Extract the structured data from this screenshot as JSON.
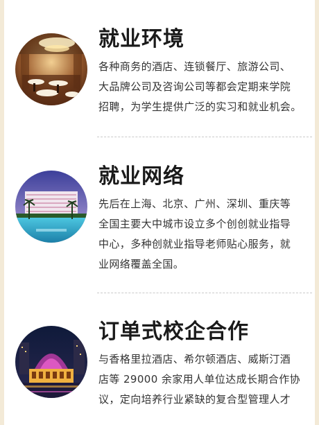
{
  "sections": [
    {
      "title": "就业环境",
      "lines": [
        "各种商务的酒店、连锁餐厅、旅游公司、",
        "大品牌公司及咨询公司等都会定期来学院",
        "招聘，为学生提供广泛的实习和就业机会。"
      ],
      "image_icon": "restaurant-photo"
    },
    {
      "title": "就业网络",
      "lines": [
        "先后在上海、北京、广州、深圳、重庆等",
        "全国主要大中城市设立多个创创就业指导",
        "中心，多种创就业指导老师贴心服务，就",
        "业网络覆盖全国。"
      ],
      "image_icon": "resort-hotel-photo"
    },
    {
      "title": "订单式校企合作",
      "lines": [
        "与香格里拉酒店、希尔顿酒店、威斯汀酒",
        "店等 29000 余家用人单位达成长期合作协",
        "议，定向培养行业紧缺的复合型管理人才"
      ],
      "image_icon": "night-hotel-photo"
    }
  ],
  "colors": {
    "side_border": "#f3ead7",
    "title": "#1a1a1a",
    "body_text": "#333333",
    "divider": "#c9c9c9"
  }
}
